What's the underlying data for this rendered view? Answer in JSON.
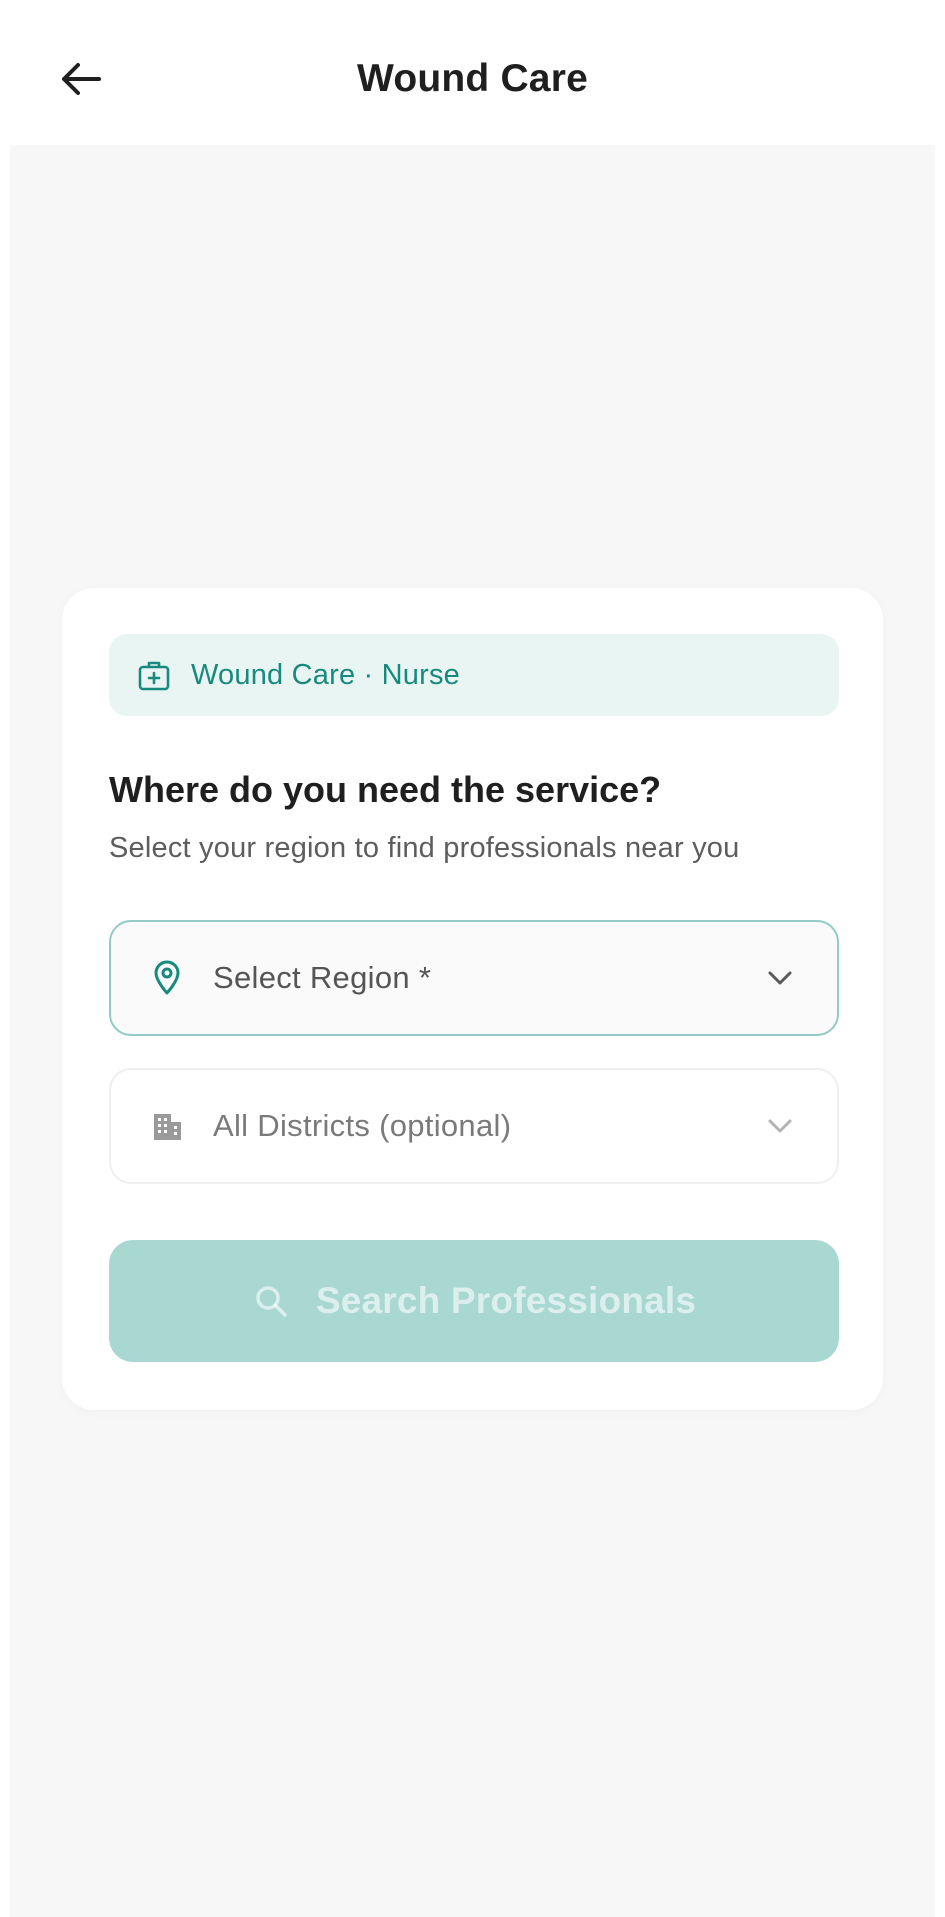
{
  "header": {
    "title": "Wound Care",
    "back_icon": "arrow-left-icon"
  },
  "card": {
    "service_chip": {
      "icon": "medical-bag-icon",
      "label": "Wound Care · Nurse"
    },
    "question": "Where do you need the service?",
    "helper": "Select your region to find professionals near you",
    "region_select": {
      "icon": "location-pin-icon",
      "label": "Select Region *",
      "chevron": "chevron-down-icon"
    },
    "district_select": {
      "icon": "building-icon",
      "label": "All Districts (optional)",
      "chevron": "chevron-down-icon"
    },
    "search_button": {
      "icon": "search-icon",
      "label": "Search Professionals",
      "enabled": false
    }
  },
  "colors": {
    "accent": "#178a7d",
    "chip_background": "#e9f5f3",
    "button_disabled": "#a9d8d2",
    "page_background": "#f7f7f7"
  }
}
